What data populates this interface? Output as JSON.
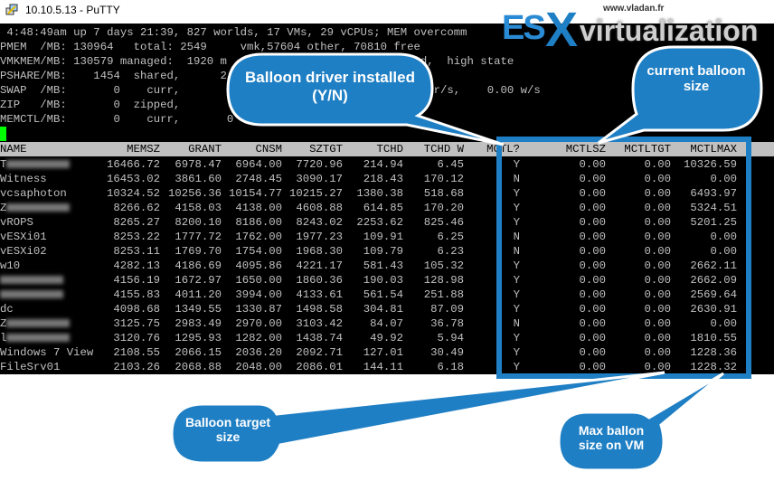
{
  "window": {
    "title": "10.10.5.13 - PuTTY",
    "icon": "putty-icon"
  },
  "summary_lines": [
    " 4:48:49am up 7 days 21:39, 827 worlds, 17 VMs, 29 vCPUs; MEM overcomm",
    "PMEM  /MB: 130964   total: 2549     vmk,57604 other, 70810 free",
    "VMKMEM/MB: 130579 managed:  1920 m                         ursvd,  high state",
    "PSHARE/MB:    1454  shared,      2",
    "SWAP  /MB:       0    curr,                                  .00 r/s,    0.00 w/s",
    "ZIP   /MB:       0  zipped,",
    "MEMCTL/MB:       0    curr,       0"
  ],
  "table": {
    "columns": [
      "NAME",
      "MEMSZ",
      "GRANT",
      "CNSM",
      "SZTGT",
      "TCHD",
      "TCHD W",
      "MCTL?",
      "MCTLSZ",
      "MCTLTGT",
      "MCTLMAX"
    ],
    "rows": [
      {
        "name": "T",
        "redacted": true,
        "v": [
          "16466.72",
          "6978.47",
          "6964.00",
          "7720.96",
          "214.94",
          "6.45",
          "Y",
          "0.00",
          "0.00",
          "10326.59"
        ]
      },
      {
        "name": "Witness",
        "v": [
          "16453.02",
          "3861.60",
          "2748.45",
          "3090.17",
          "218.43",
          "170.12",
          "N",
          "0.00",
          "0.00",
          "0.00"
        ]
      },
      {
        "name": "vcsaphoton",
        "v": [
          "10324.52",
          "10256.36",
          "10154.77",
          "10215.27",
          "1380.38",
          "518.68",
          "Y",
          "0.00",
          "0.00",
          "6493.97"
        ]
      },
      {
        "name": "Z",
        "redacted": true,
        "v": [
          "8266.62",
          "4158.03",
          "4138.00",
          "4608.88",
          "614.85",
          "170.20",
          "Y",
          "0.00",
          "0.00",
          "5324.51"
        ]
      },
      {
        "name": "vROPS",
        "v": [
          "8265.27",
          "8200.10",
          "8186.00",
          "8243.02",
          "2253.62",
          "825.46",
          "Y",
          "0.00",
          "0.00",
          "5201.25"
        ]
      },
      {
        "name": "vESXi01",
        "v": [
          "8253.22",
          "1777.72",
          "1762.00",
          "1977.23",
          "109.91",
          "6.25",
          "N",
          "0.00",
          "0.00",
          "0.00"
        ]
      },
      {
        "name": "vESXi02",
        "v": [
          "8253.11",
          "1769.70",
          "1754.00",
          "1968.30",
          "109.79",
          "6.23",
          "N",
          "0.00",
          "0.00",
          "0.00"
        ]
      },
      {
        "name": "w10",
        "v": [
          "4282.13",
          "4186.69",
          "4095.86",
          "4221.17",
          "581.43",
          "105.32",
          "Y",
          "0.00",
          "0.00",
          "2662.11"
        ]
      },
      {
        "name": "",
        "redacted": true,
        "v": [
          "4156.19",
          "1672.97",
          "1650.00",
          "1860.36",
          "190.03",
          "128.98",
          "Y",
          "0.00",
          "0.00",
          "2662.09"
        ]
      },
      {
        "name": "",
        "redacted": true,
        "v": [
          "4155.83",
          "4011.20",
          "3994.00",
          "4133.61",
          "561.54",
          "251.88",
          "Y",
          "0.00",
          "0.00",
          "2569.64"
        ]
      },
      {
        "name": "dc",
        "v": [
          "4098.68",
          "1349.55",
          "1330.87",
          "1498.58",
          "304.81",
          "87.09",
          "Y",
          "0.00",
          "0.00",
          "2630.91"
        ]
      },
      {
        "name": "Z",
        "redacted": true,
        "v": [
          "3125.75",
          "2983.49",
          "2970.00",
          "3103.42",
          "84.07",
          "36.78",
          "N",
          "0.00",
          "0.00",
          "0.00"
        ]
      },
      {
        "name": "l",
        "redacted": true,
        "v": [
          "3120.76",
          "1295.93",
          "1282.00",
          "1438.74",
          "49.92",
          "5.94",
          "Y",
          "0.00",
          "0.00",
          "1810.55"
        ]
      },
      {
        "name": "Windows 7 View",
        "v": [
          "2108.55",
          "2066.15",
          "2036.20",
          "2092.71",
          "127.01",
          "30.49",
          "Y",
          "0.00",
          "0.00",
          "1228.36"
        ]
      },
      {
        "name": "FileSrv01",
        "v": [
          "2103.26",
          "2068.88",
          "2048.00",
          "2086.01",
          "144.11",
          "6.18",
          "Y",
          "0.00",
          "0.00",
          "1228.32"
        ]
      }
    ]
  },
  "callouts": {
    "driver": "Balloon driver installed (Y/N)",
    "current": "current balloon size",
    "target": "Balloon target size",
    "max": "Max ballon size on VM"
  },
  "logo": {
    "text": "ESXvirtualization",
    "url": "www.vladan.fr"
  },
  "colors": {
    "callout": "#1f7fc4",
    "cursor": "#00ff00",
    "terminal_bg": "#000000",
    "terminal_fg": "#c0c0c0",
    "header_bg": "#c0c0c0"
  }
}
